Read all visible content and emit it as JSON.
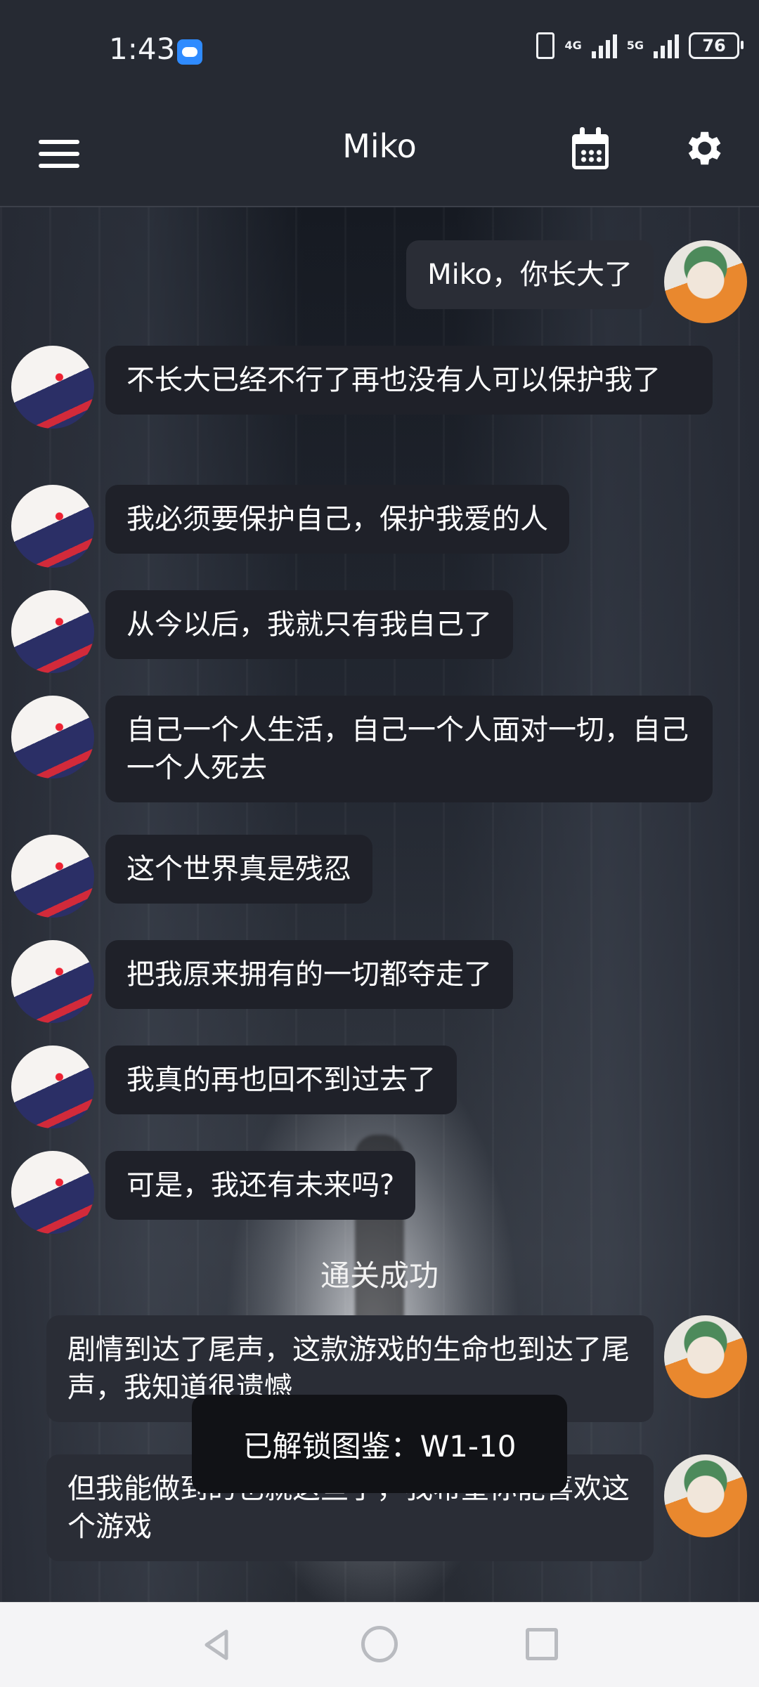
{
  "status_bar": {
    "time": "1:43",
    "network_1": "4G",
    "network_2": "5G",
    "battery": "76"
  },
  "app_bar": {
    "title": "Miko",
    "menu_icon": "menu-icon",
    "calendar_icon": "calendar-icon",
    "settings_icon": "gear-icon"
  },
  "messages": [
    {
      "sender": "me",
      "text": "Miko，你长大了"
    },
    {
      "sender": "miko",
      "text": "不长大已经不行了再也没有人可以保护我了"
    },
    {
      "sender": "miko",
      "text": "我必须要保护自己，保护我爱的人"
    },
    {
      "sender": "miko",
      "text": "从今以后，我就只有我自己了"
    },
    {
      "sender": "miko",
      "text": "自己一个人生活，自己一个人面对一切，自己一个人死去"
    },
    {
      "sender": "miko",
      "text": "这个世界真是残忍"
    },
    {
      "sender": "miko",
      "text": "把我原来拥有的一切都夺走了"
    },
    {
      "sender": "miko",
      "text": "我真的再也回不到过去了"
    },
    {
      "sender": "miko",
      "text": "可是，我还有未来吗?"
    },
    {
      "sender": "me",
      "text": "剧情到达了尾声，这款游戏的生命也到达了尾声，我知道很遗憾"
    },
    {
      "sender": "me",
      "text": "但我能做到的也就这些了，我希望你能喜欢这个游戏"
    }
  ],
  "system_message": "通关成功",
  "toast": "已解锁图鉴：W1-10",
  "nav": {
    "back_icon": "back-icon",
    "home_icon": "home-icon",
    "recent_icon": "recent-apps-icon"
  }
}
